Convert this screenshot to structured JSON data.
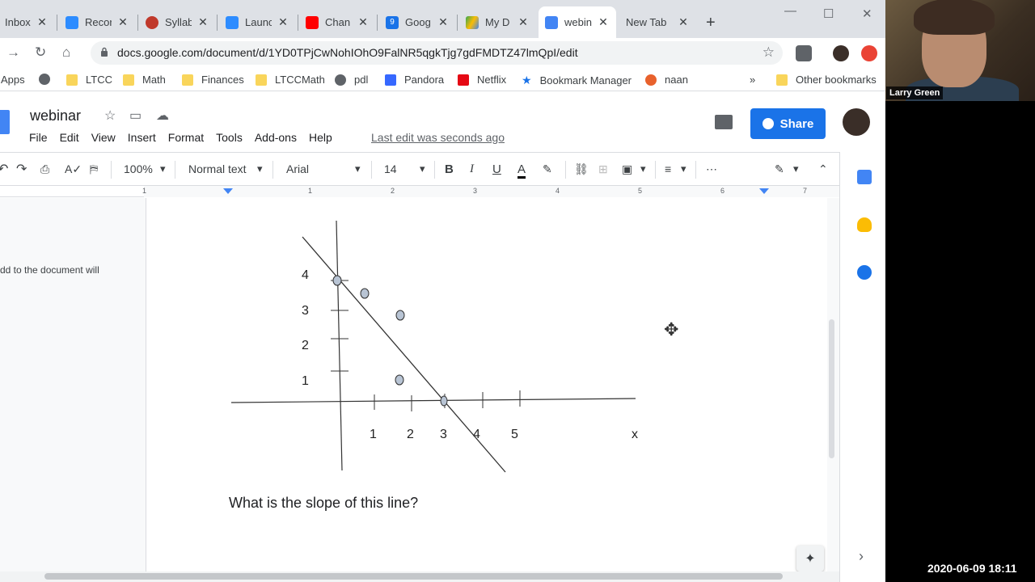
{
  "tabs": [
    {
      "label": "Inbox",
      "color": "#ffffff"
    },
    {
      "label": "Recor",
      "color": "#2d8cff"
    },
    {
      "label": "Syllab",
      "color": "#c0392b"
    },
    {
      "label": "Launc",
      "color": "#2d8cff"
    },
    {
      "label": "Chan",
      "color": "#ff0000"
    },
    {
      "label": "Goog",
      "color": "#1a73e8",
      "badge": "9"
    },
    {
      "label": "My D",
      "color": "#34a853"
    },
    {
      "label": "webin",
      "color": "#4285f4",
      "active": true
    },
    {
      "label": "New Tab",
      "color": "#dee1e6"
    }
  ],
  "url": "docs.google.com/document/d/1YD0TPjCwNohIOhO9FalNR5qgkTjg7gdFMDTZ47lmQpI/edit",
  "bookmarks": [
    {
      "label": "Apps",
      "icon": "apps-grid-icon"
    },
    {
      "label": "",
      "icon": "globe-icon"
    },
    {
      "label": "LTCC",
      "icon": "folder-icon"
    },
    {
      "label": "Math",
      "icon": "folder-icon"
    },
    {
      "label": "Finances",
      "icon": "folder-icon"
    },
    {
      "label": "LTCCMath",
      "icon": "folder-icon"
    },
    {
      "label": "pdl",
      "icon": "globe-icon"
    },
    {
      "label": "Pandora",
      "icon": "pandora-icon"
    },
    {
      "label": "Netflix",
      "icon": "netflix-icon"
    },
    {
      "label": "Bookmark Manager",
      "icon": "star-icon"
    },
    {
      "label": "naan",
      "icon": "allrecipes-icon"
    }
  ],
  "bookmarks_more": "»",
  "other_bookmarks": "Other bookmarks",
  "doc": {
    "title": "webinar",
    "menu": [
      "File",
      "Edit",
      "View",
      "Insert",
      "Format",
      "Tools",
      "Add-ons",
      "Help"
    ],
    "last_edit": "Last edit was seconds ago",
    "share": "Share"
  },
  "toolbar": {
    "zoom": "100%",
    "style": "Normal text",
    "font": "Arial",
    "size": "14"
  },
  "ruler_numbers": [
    "1",
    "1",
    "2",
    "3",
    "4",
    "5",
    "6",
    "7"
  ],
  "outline_snippet": "dd to the document will",
  "graph": {
    "y_ticks": [
      "4",
      "3",
      "2",
      "1"
    ],
    "x_ticks": [
      "1",
      "2",
      "3",
      "4",
      "5"
    ],
    "x_axis_label": "x"
  },
  "question": "What is the slope of this line?",
  "video": {
    "participant": "Larry Green",
    "timestamp": "2020-06-09  18:11"
  }
}
